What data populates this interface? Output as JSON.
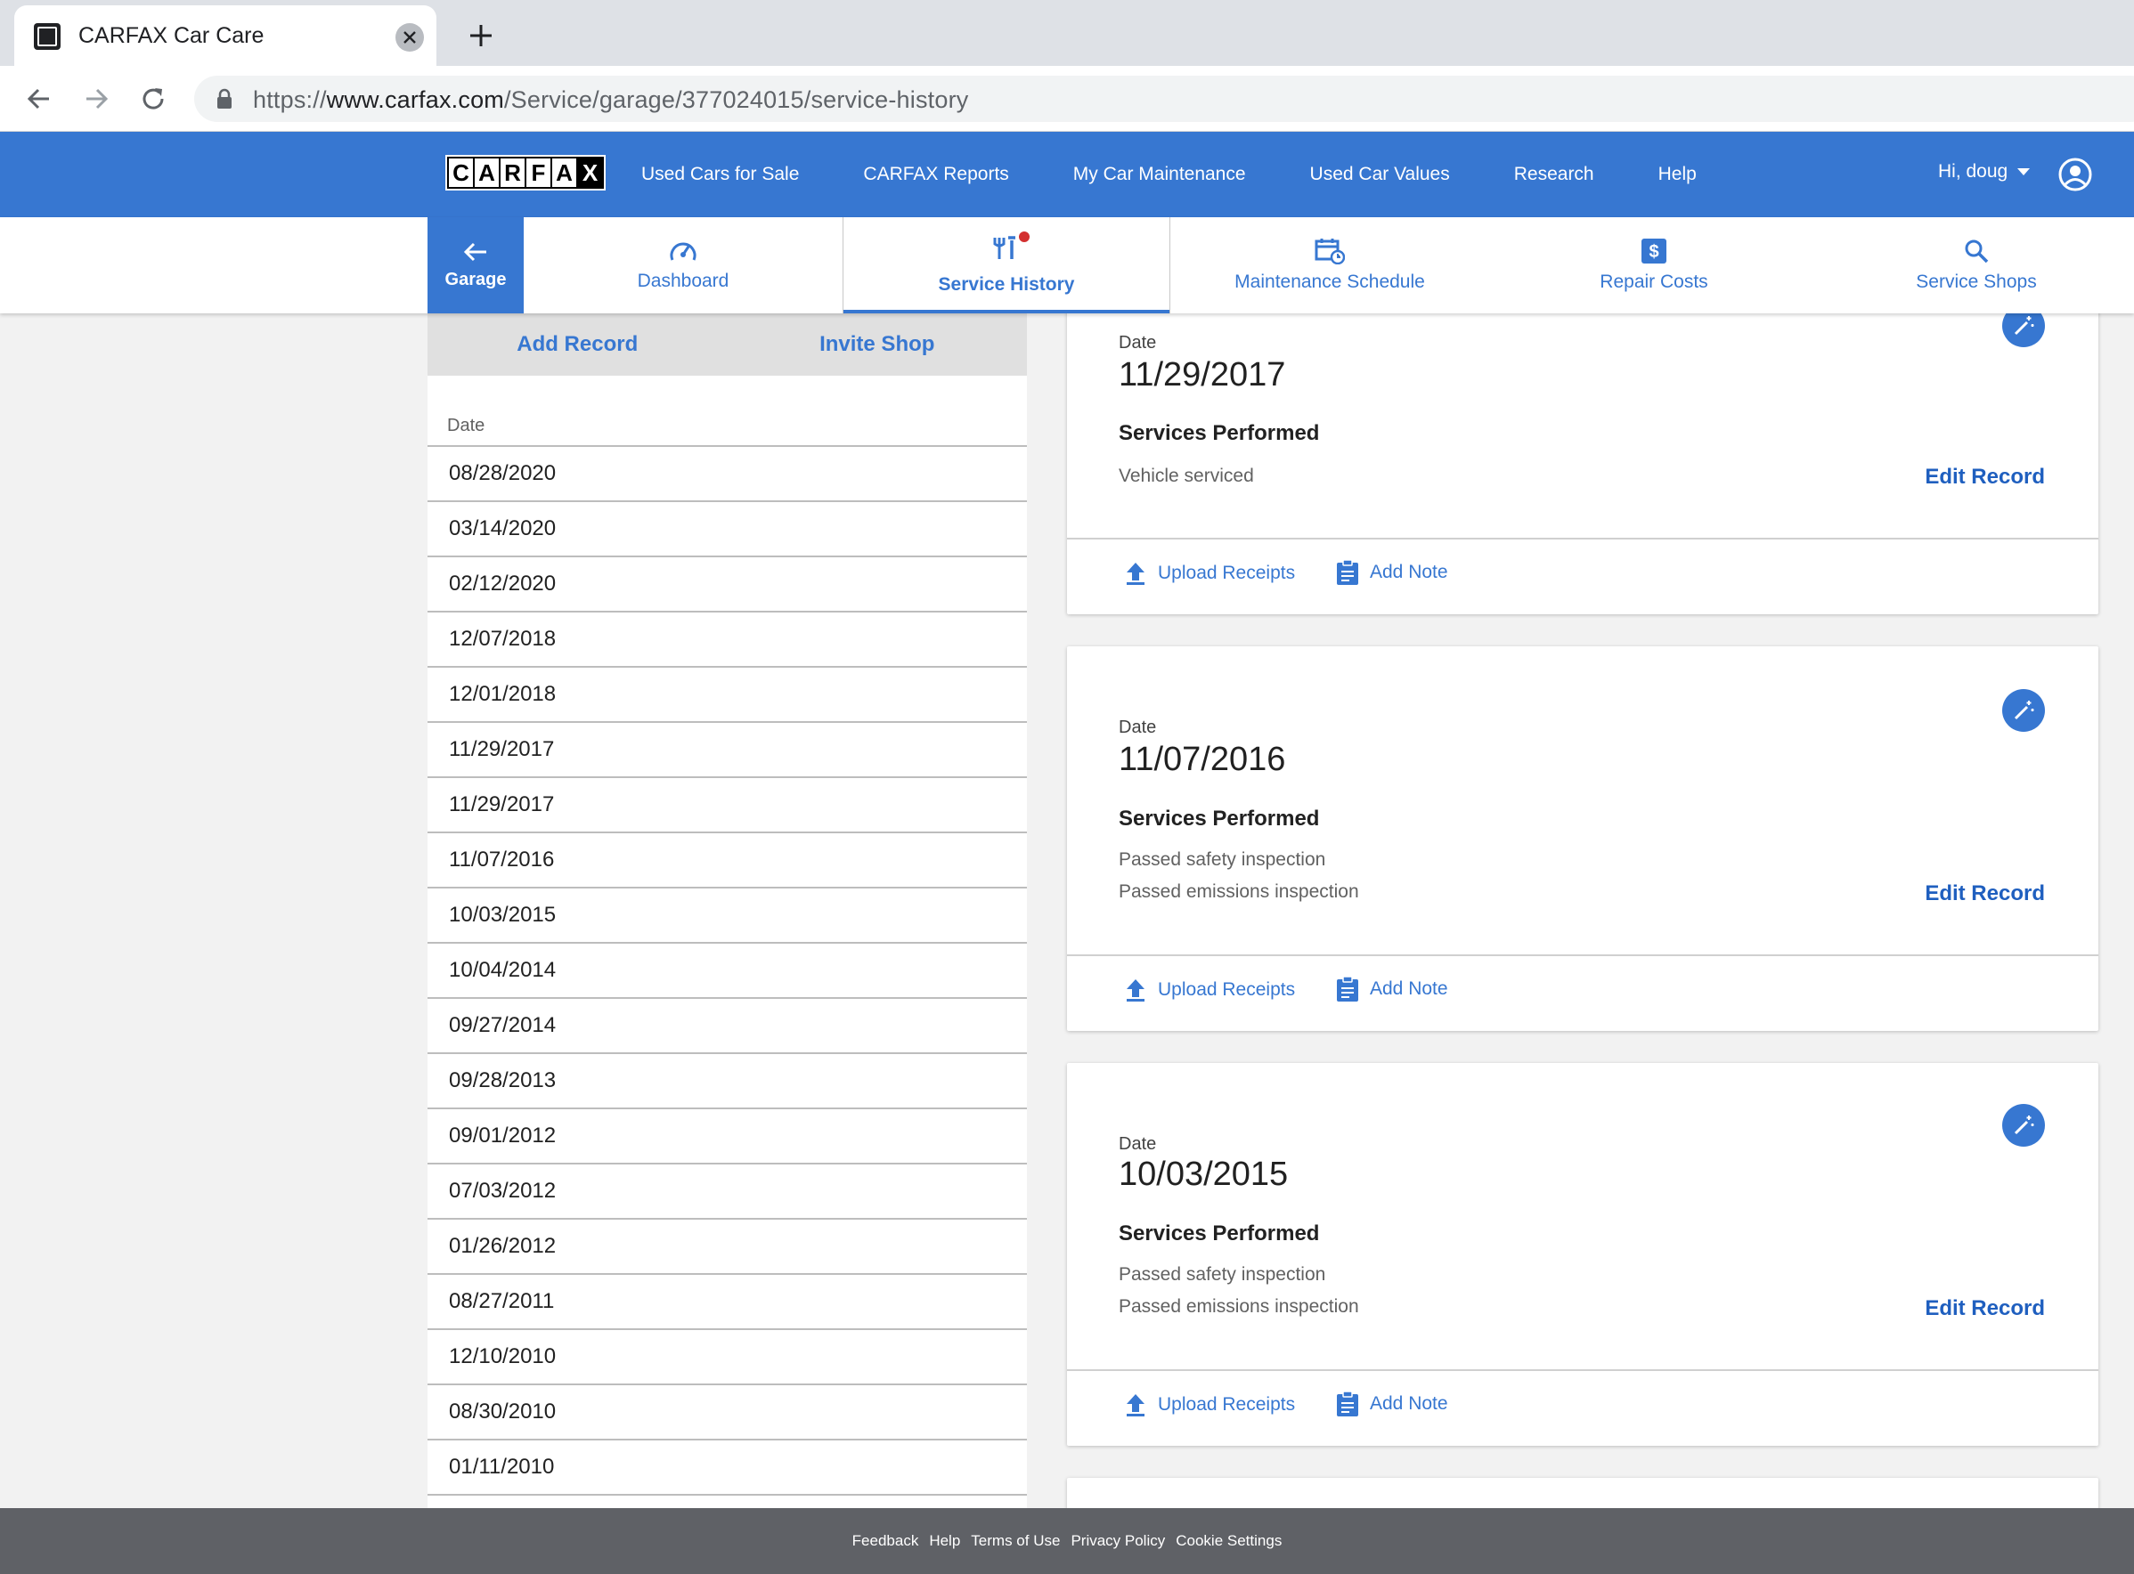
{
  "browser": {
    "tab_title": "CARFAX Car Care",
    "url_scheme": "https://",
    "url_host": "www.carfax.com",
    "url_path": "/Service/garage/377024015/service-history"
  },
  "header": {
    "logo_letters": [
      "C",
      "A",
      "R",
      "F",
      "A",
      "X"
    ],
    "nav": [
      "Used Cars for Sale",
      "CARFAX Reports",
      "My Car Maintenance",
      "Used Car Values",
      "Research",
      "Help"
    ],
    "user_greeting": "Hi, doug",
    "brand_color": "#3777d1"
  },
  "subnav": {
    "garage_label": "Garage",
    "tabs": [
      {
        "label": "Dashboard",
        "icon": "speedometer-icon"
      },
      {
        "label": "Service History",
        "icon": "tools-icon"
      },
      {
        "label": "Maintenance Schedule",
        "icon": "calendar-clock-icon"
      },
      {
        "label": "Repair Costs",
        "icon": "dollar-icon"
      },
      {
        "label": "Service Shops",
        "icon": "search-icon"
      }
    ]
  },
  "history": {
    "add_record": "Add Record",
    "invite_shop": "Invite Shop",
    "date_header": "Date",
    "dates": [
      "08/28/2020",
      "03/14/2020",
      "02/12/2020",
      "12/07/2018",
      "12/01/2018",
      "11/29/2017",
      "11/29/2017",
      "11/07/2016",
      "10/03/2015",
      "10/04/2014",
      "09/27/2014",
      "09/28/2013",
      "09/01/2012",
      "07/03/2012",
      "01/26/2012",
      "08/27/2011",
      "12/10/2010",
      "08/30/2010",
      "01/11/2010"
    ]
  },
  "cards": [
    {
      "date_label": "Date",
      "date": "11/29/2017",
      "services_title": "Services Performed",
      "services": [
        "Vehicle serviced"
      ],
      "edit": "Edit Record",
      "upload": "Upload Receipts",
      "note": "Add Note"
    },
    {
      "date_label": "Date",
      "date": "11/07/2016",
      "services_title": "Services Performed",
      "services": [
        "Passed safety inspection",
        "Passed emissions inspection"
      ],
      "edit": "Edit Record",
      "upload": "Upload Receipts",
      "note": "Add Note"
    },
    {
      "date_label": "Date",
      "date": "10/03/2015",
      "services_title": "Services Performed",
      "services": [
        "Passed safety inspection",
        "Passed emissions inspection"
      ],
      "edit": "Edit Record",
      "upload": "Upload Receipts",
      "note": "Add Note"
    }
  ],
  "footer": {
    "links": [
      "Feedback",
      "Help",
      "Terms of Use",
      "Privacy Policy",
      "Cookie Settings"
    ]
  }
}
